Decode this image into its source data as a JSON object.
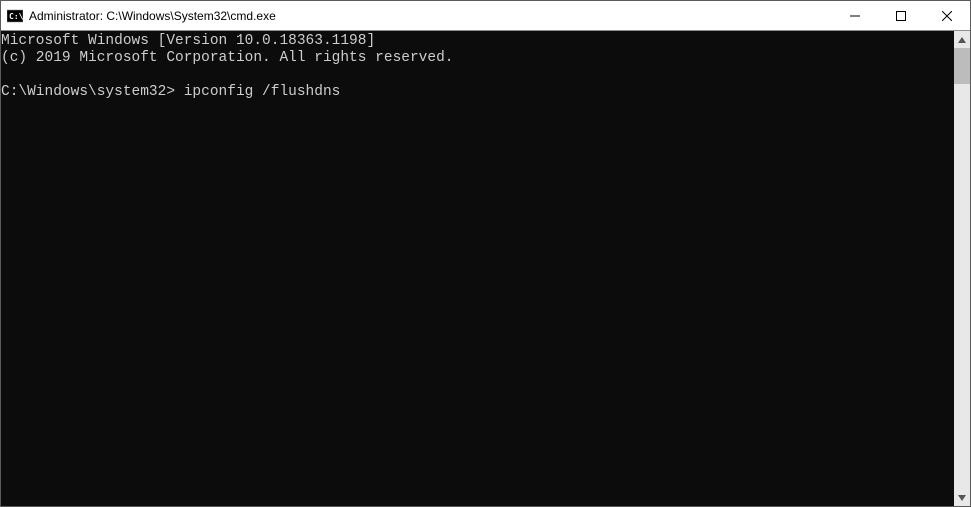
{
  "titlebar": {
    "title": "Administrator: C:\\Windows\\System32\\cmd.exe"
  },
  "terminal": {
    "line1": "Microsoft Windows [Version 10.0.18363.1198]",
    "line2": "(c) 2019 Microsoft Corporation. All rights reserved.",
    "line3": "",
    "prompt": "C:\\Windows\\system32>",
    "command": "ipconfig /flushdns"
  }
}
